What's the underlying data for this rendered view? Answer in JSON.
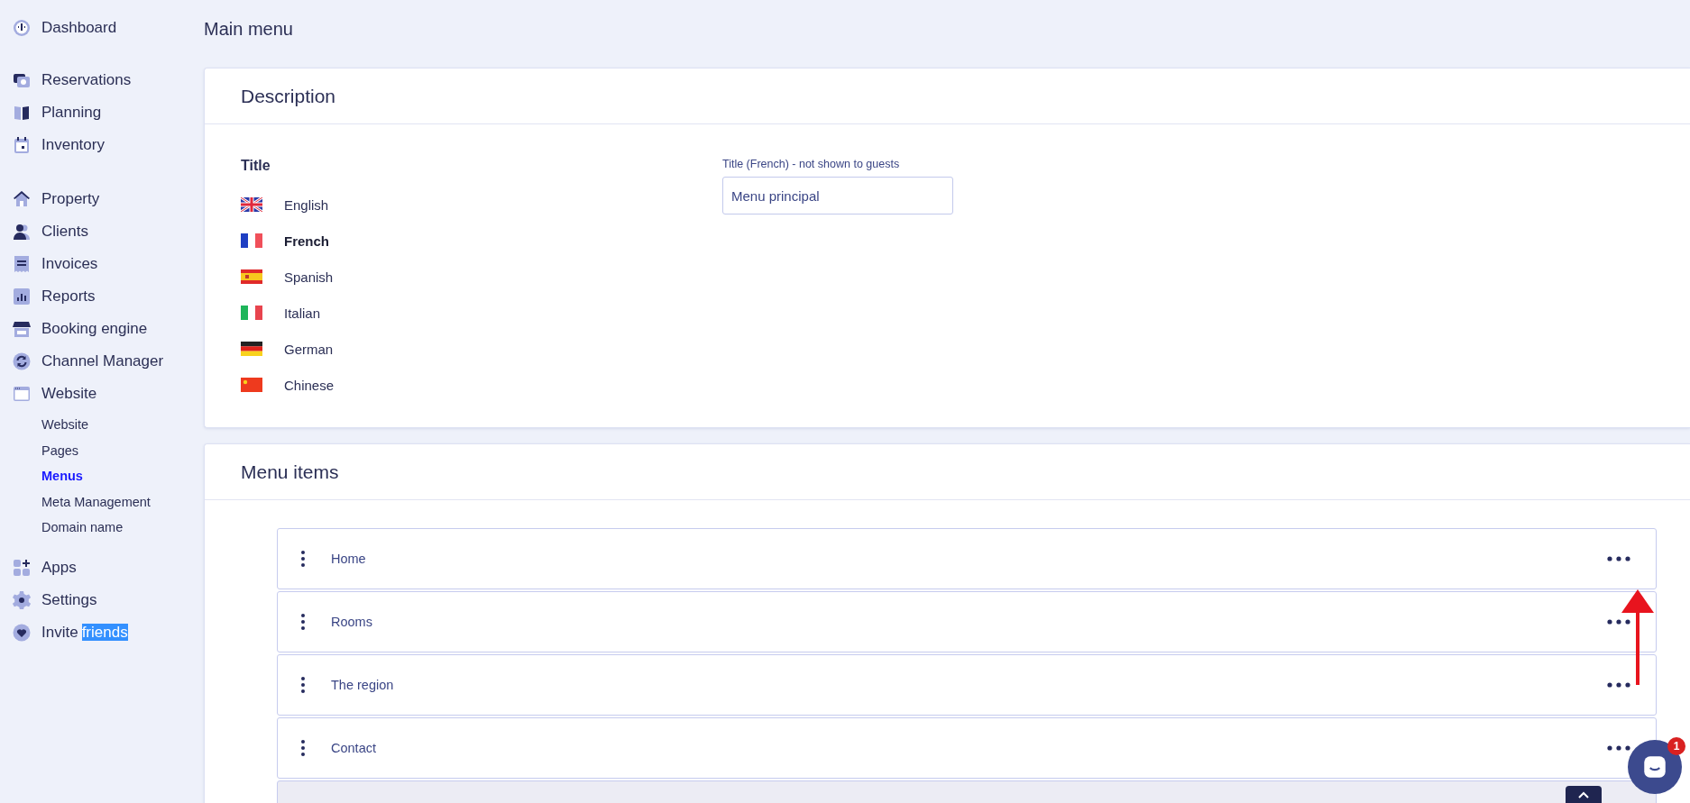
{
  "sidebar": {
    "sections": [
      {
        "items": [
          {
            "label": "Dashboard",
            "selected": false
          }
        ]
      },
      {
        "items": [
          {
            "label": "Reservations",
            "selected": false
          },
          {
            "label": "Planning",
            "selected": false
          },
          {
            "label": "Inventory",
            "selected": false
          }
        ]
      },
      {
        "items": [
          {
            "label": "Property",
            "selected": false
          },
          {
            "label": "Clients",
            "selected": false
          },
          {
            "label": "Invoices",
            "selected": false
          },
          {
            "label": "Reports",
            "selected": false
          },
          {
            "label": "Booking engine",
            "selected": false
          },
          {
            "label": "Channel Manager",
            "selected": false
          },
          {
            "label": "Website",
            "selected": false,
            "expanded": true,
            "children": [
              {
                "label": "Website",
                "selected": false
              },
              {
                "label": "Pages",
                "selected": false
              },
              {
                "label": "Menus",
                "selected": true
              },
              {
                "label": "Meta Management",
                "selected": false
              },
              {
                "label": "Domain name",
                "selected": false
              }
            ]
          }
        ]
      },
      {
        "items": [
          {
            "label": "Apps",
            "selected": false
          },
          {
            "label": "Settings",
            "selected": false
          },
          {
            "label": "Invite",
            "selected_text": "friends",
            "selected": false
          }
        ]
      }
    ]
  },
  "page_title": "Main menu",
  "description": {
    "heading": "Description",
    "title_label": "Title",
    "languages": [
      {
        "label": "English",
        "selected": false
      },
      {
        "label": "French",
        "selected": true
      },
      {
        "label": "Spanish",
        "selected": false
      },
      {
        "label": "Italian",
        "selected": false
      },
      {
        "label": "German",
        "selected": false
      },
      {
        "label": "Chinese",
        "selected": false
      }
    ],
    "field": {
      "label": "Title (French) - not shown to guests",
      "value": "Menu principal"
    }
  },
  "menu_items": {
    "heading": "Menu items",
    "items": [
      {
        "label": "Home"
      },
      {
        "label": "Rooms"
      },
      {
        "label": "The region"
      },
      {
        "label": "Contact"
      }
    ]
  },
  "chat": {
    "badge": "1"
  }
}
